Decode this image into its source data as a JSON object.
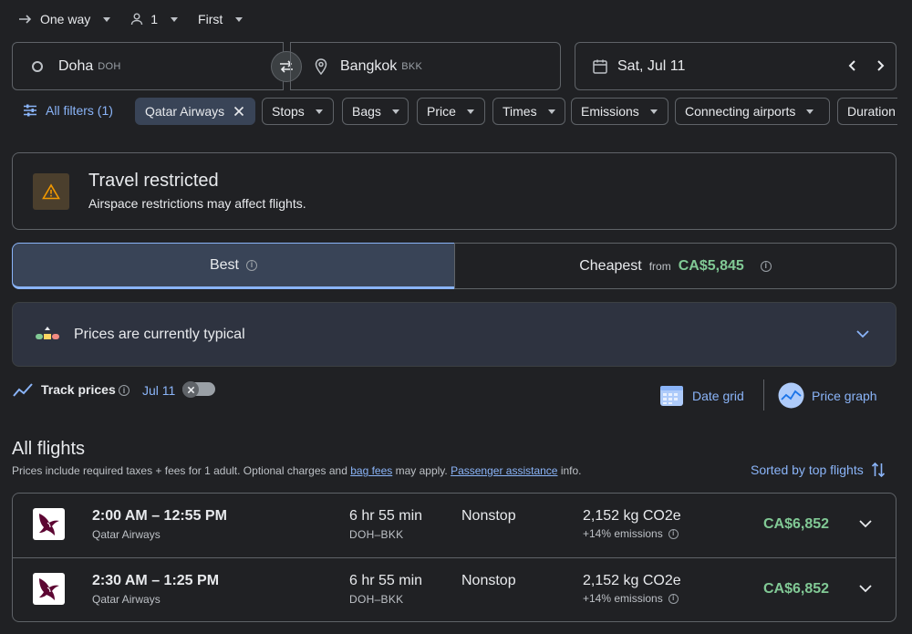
{
  "top_bar": {
    "trip_type": "One way",
    "passengers": "1",
    "cabin_class": "First"
  },
  "search": {
    "origin_city": "Doha",
    "origin_code": "DOH",
    "destination_city": "Bangkok",
    "destination_code": "BKK",
    "date": "Sat, Jul 11"
  },
  "filters": {
    "all_filters": "All filters (1)",
    "airline_chip": "Qatar Airways",
    "chips": [
      "Stops",
      "Bags",
      "Price",
      "Times",
      "Emissions",
      "Connecting airports",
      "Duration"
    ]
  },
  "restriction": {
    "title": "Travel restricted",
    "message": "Airspace restrictions may affect flights."
  },
  "tabs": {
    "best": "Best",
    "cheapest": "Cheapest",
    "cheapest_from": "from",
    "cheapest_price": "CA$5,845"
  },
  "price_insight": {
    "text": "Prices are currently typical"
  },
  "tracking": {
    "label": "Track prices",
    "date": "Jul 11",
    "date_grid": "Date grid",
    "price_graph": "Price graph"
  },
  "flights_section": {
    "title": "All flights",
    "note_prefix": "Prices include required taxes + fees for 1 adult. Optional charges and ",
    "bag_fees_link": "bag fees",
    "note_middle": " may apply. ",
    "assistance_link": "Passenger assistance",
    "note_suffix": " info.",
    "sort_label": "Sorted by top flights"
  },
  "flights": [
    {
      "time": "2:00 AM – 12:55 PM",
      "airline": "Qatar Airways",
      "duration": "6 hr 55 min",
      "route": "DOH–BKK",
      "stops": "Nonstop",
      "co2": "2,152 kg CO2e",
      "emissions": "+14% emissions",
      "price": "CA$6,852"
    },
    {
      "time": "2:30 AM – 1:25 PM",
      "airline": "Qatar Airways",
      "duration": "6 hr 55 min",
      "route": "DOH–BKK",
      "stops": "Nonstop",
      "co2": "2,152 kg CO2e",
      "emissions": "+14% emissions",
      "price": "CA$6,852"
    }
  ],
  "colors": {
    "background": "#202124",
    "accent_blue": "#8ab4f8",
    "price_green": "#81c995",
    "warning_orange": "#f29900"
  }
}
